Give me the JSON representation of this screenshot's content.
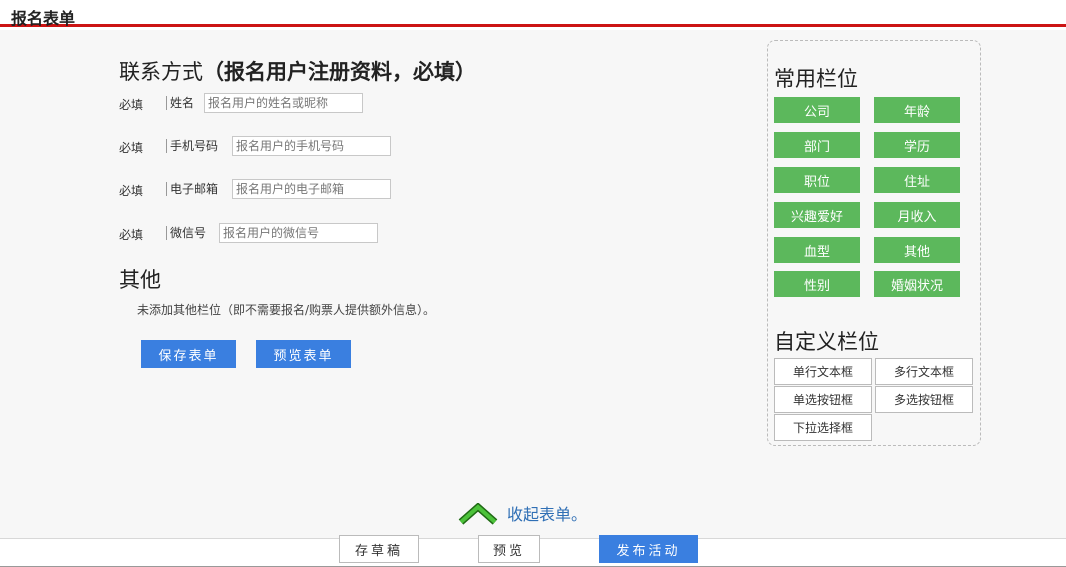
{
  "header": {
    "title": "报名表单"
  },
  "contact": {
    "title_main": "联系方式",
    "title_sub": "（报名用户注册资料，必填）",
    "fields": [
      {
        "required": "必填",
        "label": "姓名",
        "placeholder": "报名用户的姓名或昵称"
      },
      {
        "required": "必填",
        "label": "手机号码",
        "placeholder": "报名用户的手机号码"
      },
      {
        "required": "必填",
        "label": "电子邮箱",
        "placeholder": "报名用户的电子邮箱"
      },
      {
        "required": "必填",
        "label": "微信号",
        "placeholder": "报名用户的微信号"
      }
    ]
  },
  "other": {
    "title": "其他",
    "description": "未添加其他栏位（即不需要报名/购票人提供额外信息）。"
  },
  "actions": {
    "save_form": "保存表单",
    "preview_form": "预览表单"
  },
  "side_panel": {
    "common_title": "常用栏位",
    "common_fields": [
      "公司",
      "年龄",
      "部门",
      "学历",
      "职位",
      "住址",
      "兴趣爱好",
      "月收入",
      "血型",
      "其他",
      "性别",
      "婚姻状况"
    ],
    "custom_title": "自定义栏位",
    "custom_fields": [
      "单行文本框",
      "多行文本框",
      "单选按钮框",
      "多选按钮框",
      "下拉选择框"
    ]
  },
  "collapse": {
    "label": "收起表单。"
  },
  "footer": {
    "save_draft": "存草稿",
    "preview": "预览",
    "publish": "发布活动"
  },
  "colors": {
    "header_rule": "#cc1414",
    "primary_blue": "#3a7fe0",
    "field_green": "#5cb85c",
    "collapse_green": "#2e9e1e",
    "link_blue": "#2f6fb5"
  }
}
